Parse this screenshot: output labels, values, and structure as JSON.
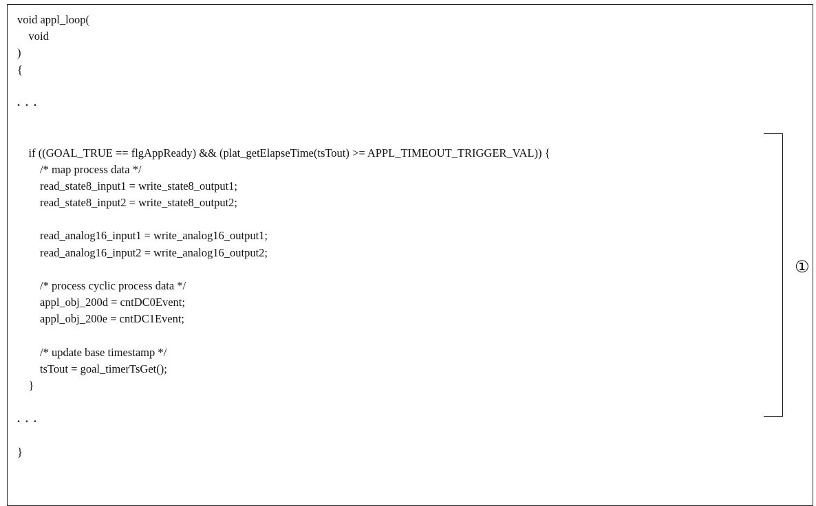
{
  "code_lines": [
    "void appl_loop(",
    "    void",
    ")",
    "{",
    "",
    ". . .",
    "",
    "",
    "    if ((GOAL_TRUE == flgAppReady) && (plat_getElapseTime(tsTout) >= APPL_TIMEOUT_TRIGGER_VAL)) {",
    "        /* map process data */",
    "        read_state8_input1 = write_state8_output1;",
    "        read_state8_input2 = write_state8_output2;",
    "",
    "        read_analog16_input1 = write_analog16_output1;",
    "        read_analog16_input2 = write_analog16_output2;",
    "",
    "        /* process cyclic process data */",
    "        appl_obj_200d = cntDC0Event;",
    "        appl_obj_200e = cntDC1Event;",
    "",
    "        /* update base timestamp */",
    "        tsTout = goal_timerTsGet();",
    "    }",
    "",
    ". . .",
    "",
    "}"
  ],
  "annotation": {
    "marker": "①"
  }
}
